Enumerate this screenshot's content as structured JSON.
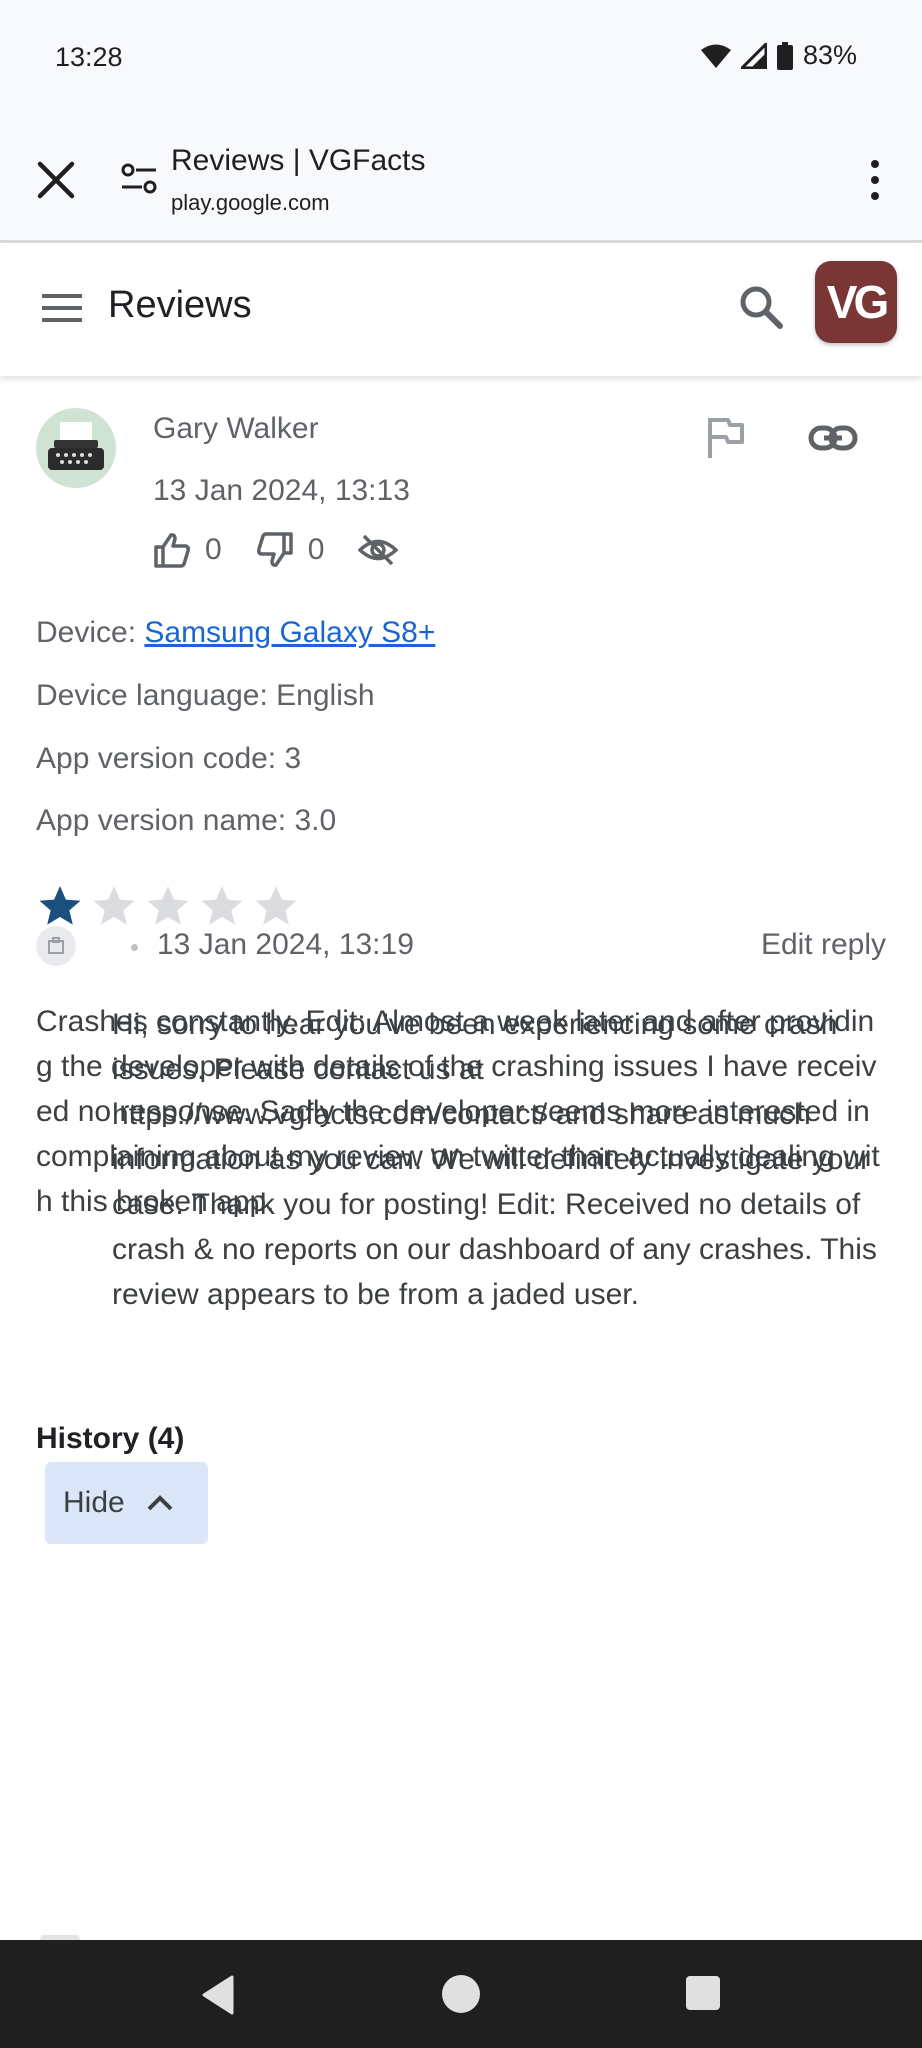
{
  "status_bar": {
    "time": "13:28",
    "battery": "83%"
  },
  "browser": {
    "title": "Reviews | VGFacts",
    "url": "play.google.com"
  },
  "app_bar": {
    "title": "Reviews",
    "logo_text": "VG"
  },
  "review": {
    "author": "Gary Walker",
    "date": "13 Jan 2024, 13:13",
    "thumbs_up_count": "0",
    "thumbs_down_count": "0",
    "device_label": "Device: ",
    "device_name": "Samsung Galaxy S8+",
    "device_language": "Device language: English",
    "app_version_code": "App version code: 3",
    "app_version_name": "App version name: 3.0",
    "rating": 1,
    "rating_max": 5,
    "text": "Crashes constantly. Edit: Almost a week later and after providing the developer with details of the crashing issues I have received no response. Sadly the developer seems more interested in complaining about my review on twitter than actually dealing with this broken app."
  },
  "reply": {
    "date": "13 Jan 2024, 13:19",
    "edit_label": "Edit reply",
    "text": "Hi, sorry to hear you’ve been experiencing some crash issues. Please contact us at https://www.vgfacts.com/contact/ and share as much information as you can. We will definitely investigate your case. Thank you for posting! Edit: Received no details of crash & no reports on our dashboard of any crashes. This review appears to be from a jaded user."
  },
  "history": {
    "label": "History (4)",
    "hide_label": "Hide"
  },
  "colors": {
    "star_filled": "#1b4f7e",
    "star_empty": "#dadce0",
    "link": "#1a66d2",
    "logo_bg": "#7a3535"
  }
}
